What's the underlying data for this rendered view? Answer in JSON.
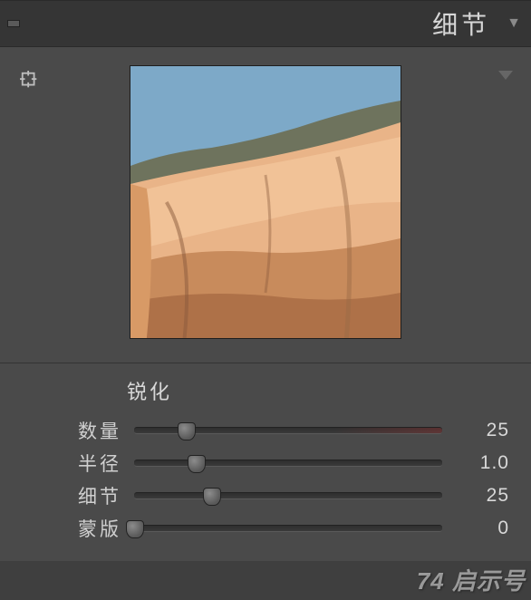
{
  "panel": {
    "title": "细节"
  },
  "sharpening": {
    "title": "锐化",
    "sliders": {
      "amount": {
        "label": "数量",
        "value": 25,
        "display": "25",
        "min": 0,
        "max": 150,
        "tint": true
      },
      "radius": {
        "label": "半径",
        "value": 1.0,
        "display": "1.0",
        "min": 0.5,
        "max": 3.0
      },
      "detail": {
        "label": "细节",
        "value": 25,
        "display": "25",
        "min": 0,
        "max": 100
      },
      "masking": {
        "label": "蒙版",
        "value": 0,
        "display": "0",
        "min": 0,
        "max": 100
      }
    }
  },
  "watermark": "74 启示号"
}
